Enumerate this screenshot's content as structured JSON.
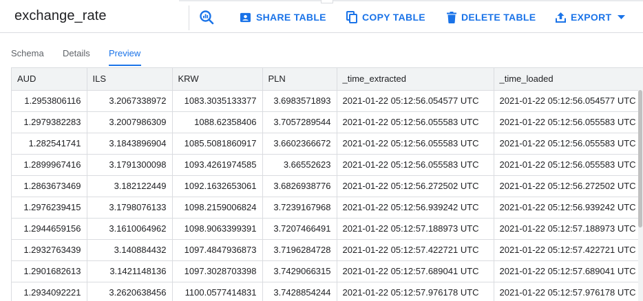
{
  "header": {
    "title": "exchange_rate",
    "buttons": {
      "share": "SHARE TABLE",
      "copy": "COPY TABLE",
      "delete": "DELETE TABLE",
      "export": "EXPORT"
    },
    "icons": [
      "query-icon",
      "share-icon",
      "copy-icon",
      "delete-icon",
      "export-icon",
      "dropdown-arrow-icon"
    ]
  },
  "tabs": [
    {
      "label": "Schema",
      "active": false
    },
    {
      "label": "Details",
      "active": false
    },
    {
      "label": "Preview",
      "active": true
    }
  ],
  "table": {
    "columns": [
      "AUD",
      "ILS",
      "KRW",
      "PLN",
      "_time_extracted",
      "_time_loaded"
    ],
    "rows": [
      [
        "1.2953806116",
        "3.2067338972",
        "1083.3035133377",
        "3.6983571893",
        "2021-01-22 05:12:56.054577 UTC",
        "2021-01-22 05:12:56.054577 UTC"
      ],
      [
        "1.2979382283",
        "3.2007986309",
        "1088.62358406",
        "3.7057289544",
        "2021-01-22 05:12:56.055583 UTC",
        "2021-01-22 05:12:56.055583 UTC"
      ],
      [
        "1.282541741",
        "3.1843896904",
        "1085.5081860917",
        "3.6602366672",
        "2021-01-22 05:12:56.055583 UTC",
        "2021-01-22 05:12:56.055583 UTC"
      ],
      [
        "1.2899967416",
        "3.1791300098",
        "1093.4261974585",
        "3.66552623",
        "2021-01-22 05:12:56.055583 UTC",
        "2021-01-22 05:12:56.055583 UTC"
      ],
      [
        "1.2863673469",
        "3.182122449",
        "1092.1632653061",
        "3.6826938776",
        "2021-01-22 05:12:56.272502 UTC",
        "2021-01-22 05:12:56.272502 UTC"
      ],
      [
        "1.2976239415",
        "3.1798076133",
        "1098.2159006824",
        "3.7239167968",
        "2021-01-22 05:12:56.939242 UTC",
        "2021-01-22 05:12:56.939242 UTC"
      ],
      [
        "1.2944659156",
        "3.1610064962",
        "1098.9063399391",
        "3.7207466491",
        "2021-01-22 05:12:57.188973 UTC",
        "2021-01-22 05:12:57.188973 UTC"
      ],
      [
        "1.2932763439",
        "3.140884432",
        "1097.4847936873",
        "3.7196284728",
        "2021-01-22 05:12:57.422721 UTC",
        "2021-01-22 05:12:57.422721 UTC"
      ],
      [
        "1.2901682613",
        "3.1421148136",
        "1097.3028703398",
        "3.7429066315",
        "2021-01-22 05:12:57.689041 UTC",
        "2021-01-22 05:12:57.689041 UTC"
      ],
      [
        "1.2934092221",
        "3.2620638456",
        "1100.0577414831",
        "3.7428854244",
        "2021-01-22 05:12:57.976178 UTC",
        "2021-01-22 05:12:57.976178 UTC"
      ]
    ]
  },
  "colors": {
    "accent": "#1a73e8",
    "header_bg": "#f1f3f4",
    "border": "#dadce0",
    "text": "#202124",
    "muted": "#5f6368"
  }
}
